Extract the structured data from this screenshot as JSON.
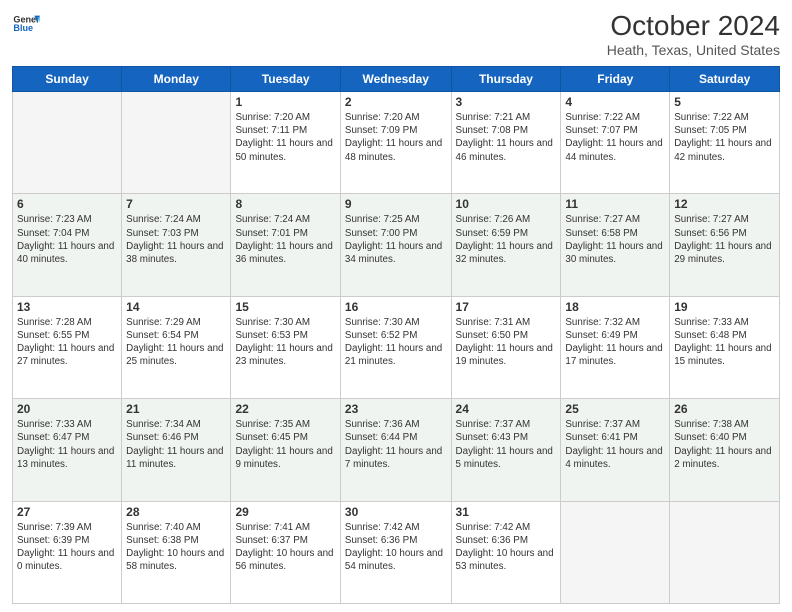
{
  "header": {
    "logo_line1": "General",
    "logo_line2": "Blue",
    "title": "October 2024",
    "subtitle": "Heath, Texas, United States"
  },
  "columns": [
    "Sunday",
    "Monday",
    "Tuesday",
    "Wednesday",
    "Thursday",
    "Friday",
    "Saturday"
  ],
  "weeks": [
    [
      {
        "day": "",
        "info": ""
      },
      {
        "day": "",
        "info": ""
      },
      {
        "day": "1",
        "info": "Sunrise: 7:20 AM\nSunset: 7:11 PM\nDaylight: 11 hours and 50 minutes."
      },
      {
        "day": "2",
        "info": "Sunrise: 7:20 AM\nSunset: 7:09 PM\nDaylight: 11 hours and 48 minutes."
      },
      {
        "day": "3",
        "info": "Sunrise: 7:21 AM\nSunset: 7:08 PM\nDaylight: 11 hours and 46 minutes."
      },
      {
        "day": "4",
        "info": "Sunrise: 7:22 AM\nSunset: 7:07 PM\nDaylight: 11 hours and 44 minutes."
      },
      {
        "day": "5",
        "info": "Sunrise: 7:22 AM\nSunset: 7:05 PM\nDaylight: 11 hours and 42 minutes."
      }
    ],
    [
      {
        "day": "6",
        "info": "Sunrise: 7:23 AM\nSunset: 7:04 PM\nDaylight: 11 hours and 40 minutes."
      },
      {
        "day": "7",
        "info": "Sunrise: 7:24 AM\nSunset: 7:03 PM\nDaylight: 11 hours and 38 minutes."
      },
      {
        "day": "8",
        "info": "Sunrise: 7:24 AM\nSunset: 7:01 PM\nDaylight: 11 hours and 36 minutes."
      },
      {
        "day": "9",
        "info": "Sunrise: 7:25 AM\nSunset: 7:00 PM\nDaylight: 11 hours and 34 minutes."
      },
      {
        "day": "10",
        "info": "Sunrise: 7:26 AM\nSunset: 6:59 PM\nDaylight: 11 hours and 32 minutes."
      },
      {
        "day": "11",
        "info": "Sunrise: 7:27 AM\nSunset: 6:58 PM\nDaylight: 11 hours and 30 minutes."
      },
      {
        "day": "12",
        "info": "Sunrise: 7:27 AM\nSunset: 6:56 PM\nDaylight: 11 hours and 29 minutes."
      }
    ],
    [
      {
        "day": "13",
        "info": "Sunrise: 7:28 AM\nSunset: 6:55 PM\nDaylight: 11 hours and 27 minutes."
      },
      {
        "day": "14",
        "info": "Sunrise: 7:29 AM\nSunset: 6:54 PM\nDaylight: 11 hours and 25 minutes."
      },
      {
        "day": "15",
        "info": "Sunrise: 7:30 AM\nSunset: 6:53 PM\nDaylight: 11 hours and 23 minutes."
      },
      {
        "day": "16",
        "info": "Sunrise: 7:30 AM\nSunset: 6:52 PM\nDaylight: 11 hours and 21 minutes."
      },
      {
        "day": "17",
        "info": "Sunrise: 7:31 AM\nSunset: 6:50 PM\nDaylight: 11 hours and 19 minutes."
      },
      {
        "day": "18",
        "info": "Sunrise: 7:32 AM\nSunset: 6:49 PM\nDaylight: 11 hours and 17 minutes."
      },
      {
        "day": "19",
        "info": "Sunrise: 7:33 AM\nSunset: 6:48 PM\nDaylight: 11 hours and 15 minutes."
      }
    ],
    [
      {
        "day": "20",
        "info": "Sunrise: 7:33 AM\nSunset: 6:47 PM\nDaylight: 11 hours and 13 minutes."
      },
      {
        "day": "21",
        "info": "Sunrise: 7:34 AM\nSunset: 6:46 PM\nDaylight: 11 hours and 11 minutes."
      },
      {
        "day": "22",
        "info": "Sunrise: 7:35 AM\nSunset: 6:45 PM\nDaylight: 11 hours and 9 minutes."
      },
      {
        "day": "23",
        "info": "Sunrise: 7:36 AM\nSunset: 6:44 PM\nDaylight: 11 hours and 7 minutes."
      },
      {
        "day": "24",
        "info": "Sunrise: 7:37 AM\nSunset: 6:43 PM\nDaylight: 11 hours and 5 minutes."
      },
      {
        "day": "25",
        "info": "Sunrise: 7:37 AM\nSunset: 6:41 PM\nDaylight: 11 hours and 4 minutes."
      },
      {
        "day": "26",
        "info": "Sunrise: 7:38 AM\nSunset: 6:40 PM\nDaylight: 11 hours and 2 minutes."
      }
    ],
    [
      {
        "day": "27",
        "info": "Sunrise: 7:39 AM\nSunset: 6:39 PM\nDaylight: 11 hours and 0 minutes."
      },
      {
        "day": "28",
        "info": "Sunrise: 7:40 AM\nSunset: 6:38 PM\nDaylight: 10 hours and 58 minutes."
      },
      {
        "day": "29",
        "info": "Sunrise: 7:41 AM\nSunset: 6:37 PM\nDaylight: 10 hours and 56 minutes."
      },
      {
        "day": "30",
        "info": "Sunrise: 7:42 AM\nSunset: 6:36 PM\nDaylight: 10 hours and 54 minutes."
      },
      {
        "day": "31",
        "info": "Sunrise: 7:42 AM\nSunset: 6:36 PM\nDaylight: 10 hours and 53 minutes."
      },
      {
        "day": "",
        "info": ""
      },
      {
        "day": "",
        "info": ""
      }
    ]
  ]
}
